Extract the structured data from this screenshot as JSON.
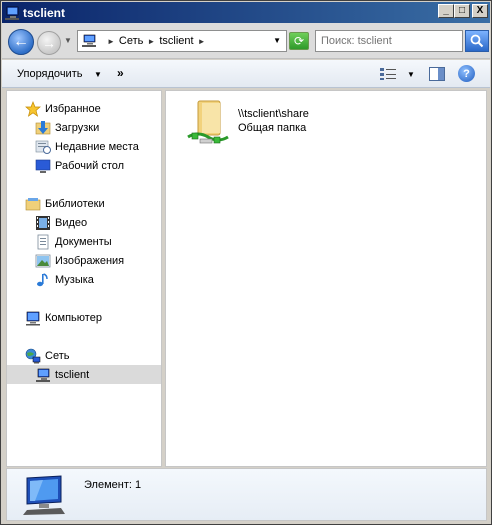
{
  "window": {
    "title": "tsclient"
  },
  "title_buttons": {
    "minimize": "_",
    "maximize": "□",
    "close": "X"
  },
  "address_bar": {
    "crumbs": [
      "Сеть",
      "tsclient"
    ]
  },
  "search": {
    "placeholder": "Поиск: tsclient"
  },
  "toolbar": {
    "organize_label": "Упорядочить",
    "more_label": "»"
  },
  "sidebar": {
    "favorites": {
      "label": "Избранное",
      "icon": "star-icon",
      "items": [
        {
          "label": "Загрузки",
          "icon": "downloads-folder-icon"
        },
        {
          "label": "Недавние места",
          "icon": "recent-places-icon"
        },
        {
          "label": "Рабочий стол",
          "icon": "desktop-icon"
        }
      ]
    },
    "libraries": {
      "label": "Библиотеки",
      "icon": "libraries-icon",
      "items": [
        {
          "label": "Видео",
          "icon": "video-library-icon"
        },
        {
          "label": "Документы",
          "icon": "documents-library-icon"
        },
        {
          "label": "Изображения",
          "icon": "pictures-library-icon"
        },
        {
          "label": "Музыка",
          "icon": "music-library-icon"
        }
      ]
    },
    "computer": {
      "label": "Компьютер",
      "icon": "computer-icon"
    },
    "network": {
      "label": "Сеть",
      "icon": "network-icon",
      "items": [
        {
          "label": "tsclient",
          "icon": "network-computer-icon",
          "selected": true
        }
      ]
    }
  },
  "content": {
    "items": [
      {
        "name": "\\\\tsclient\\share",
        "type": "Общая папка",
        "icon": "shared-folder-icon"
      }
    ]
  },
  "details": {
    "summary": "Элемент: 1"
  }
}
